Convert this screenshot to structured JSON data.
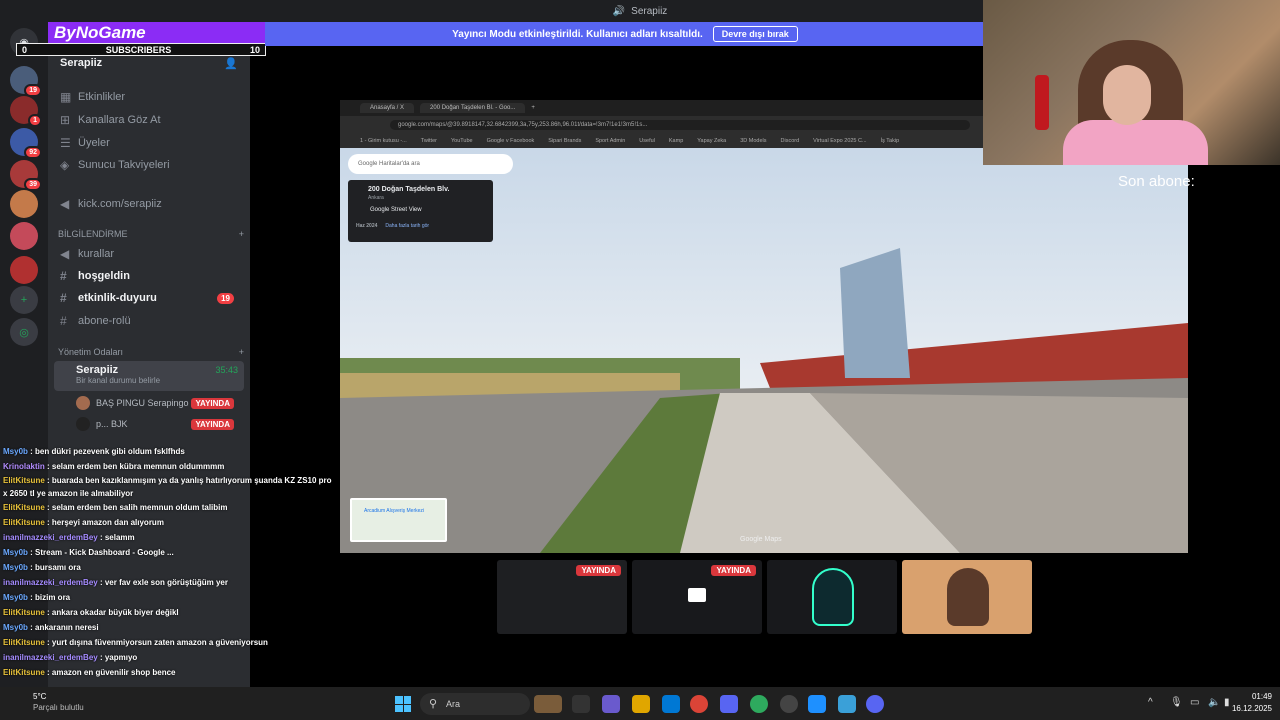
{
  "window": {
    "title": "Serapiiz"
  },
  "notice": {
    "text": "Yayıncı Modu etkinleştirildi. Kullanıcı adları kısaltıldı.",
    "button": "Devre dışı bırak"
  },
  "overlay": {
    "brand": "ByNoGame",
    "subscribers_label": "SUBSCRIBERS",
    "subs_left": "0",
    "subs_right": "10",
    "last_sub": "Son abone:"
  },
  "servers": [
    {
      "icon": "discord-icon",
      "badge": ""
    },
    {
      "icon": "server-icon",
      "badge": "19"
    },
    {
      "icon": "server-icon",
      "badge": "1"
    },
    {
      "icon": "server-icon",
      "badge": "92"
    },
    {
      "icon": "server-icon",
      "badge": "39"
    },
    {
      "icon": "server-icon",
      "badge": ""
    },
    {
      "icon": "server-icon",
      "badge": ""
    },
    {
      "icon": "server-icon",
      "badge": ""
    }
  ],
  "sidebar": {
    "server_name": "Serapiiz",
    "items": {
      "events": "Etkinlikler",
      "browse": "Kanallara Göz At",
      "members": "Üyeler",
      "boosts": "Sunucu Takviyeleri",
      "kick": "kick.com/serapiiz"
    },
    "cat_info": "BİLGİLENDİRME",
    "channels": {
      "rules": "kurallar",
      "welcome": "hoşgeldin",
      "events": "etkinlik-duyuru",
      "events_count": "19",
      "subrole": "abone-rolü"
    },
    "cat_admin": "Yönetim Odaları",
    "voice": {
      "name": "Serapiiz",
      "time": "35:43",
      "status": "Bir kanal durumu belirle"
    },
    "voice_users": [
      {
        "name": "BAŞ PINGU Serapingo",
        "live": "YAYINDA"
      },
      {
        "name": "p... BJK",
        "live": "YAYINDA"
      }
    ]
  },
  "chat": [
    {
      "user": "Msy0b",
      "color": "#6ba8ff",
      "text": "ben dükri pezevenk gibi oldum fsklfhds"
    },
    {
      "user": "Krinolaktin",
      "color": "#b38cff",
      "text": "selam erdem ben kübra memnun oldummmm"
    },
    {
      "user": "ElitKitsune",
      "color": "#e8c23a",
      "text": "buarada ben kazıklanmışım ya da yanlış hatırlıyorum şuanda KZ ZS10 pro x 2650 tl ye amazon ile almabiliyor"
    },
    {
      "user": "ElitKitsune",
      "color": "#e8c23a",
      "text": "selam erdem ben salih memnun oldum talibim"
    },
    {
      "user": "ElitKitsune",
      "color": "#e8c23a",
      "text": "herşeyi amazon dan alıyorum"
    },
    {
      "user": "inanilmazzeki_erdemBey",
      "color": "#a58bff",
      "text": "selamm"
    },
    {
      "user": "Msy0b",
      "color": "#6ba8ff",
      "text": "Stream - Kick Dashboard - Google ..."
    },
    {
      "user": "Msy0b",
      "color": "#6ba8ff",
      "text": "bursamı ora"
    },
    {
      "user": "inanilmazzeki_erdemBey",
      "color": "#a58bff",
      "text": "ver fav exle son görüştüğüm yer"
    },
    {
      "user": "Msy0b",
      "color": "#6ba8ff",
      "text": "bizim ora"
    },
    {
      "user": "ElitKitsune",
      "color": "#e8c23a",
      "text": "ankara okadar büyük biyer değikl"
    },
    {
      "user": "Msy0b",
      "color": "#6ba8ff",
      "text": "ankaranın neresi"
    },
    {
      "user": "ElitKitsune",
      "color": "#e8c23a",
      "text": "yurt dışına füvenmiyorsun zaten amazon a güveniyorsun"
    },
    {
      "user": "inanilmazzeki_erdemBey",
      "color": "#a58bff",
      "text": "yapmıyo"
    },
    {
      "user": "ElitKitsune",
      "color": "#e8c23a",
      "text": "amazon en güvenilir shop bence"
    }
  ],
  "browser": {
    "tabs": [
      "Anasayfa / X",
      "200 Doğan Taşdelen Bl. - Goo..."
    ],
    "url": "google.com/maps/@39.8918147,32.6842399,3a,75y,253.86h,96.01t/data=!3m7!1e1!3m5!1s...",
    "bookmarks": [
      "1 - Girim kutusu -...",
      "Twitter",
      "YouTube",
      "Google v Facebook",
      "Sipari Brands",
      "Sport Admin",
      "Useful",
      "Kamp",
      "Yapay Zeka",
      "3D Models",
      "Discord",
      "Virtual Expo 2025 C...",
      "İş Takip"
    ]
  },
  "streetview": {
    "search_placeholder": "Google Haritalar'da ara",
    "place": "200 Doğan Taşdelen Blv.",
    "city": "Ankara",
    "source": "Google Street View",
    "date": "Haz 2024",
    "more_dates": "Daha fazla tarih gör",
    "minimap_label": "Arcadium Alışveriş Merkezi",
    "watermark": "Google Maps"
  },
  "thumbs": [
    {
      "live": "YAYINDA"
    },
    {
      "live": "YAYINDA"
    },
    {
      "live": ""
    },
    {
      "live": ""
    }
  ],
  "taskbar": {
    "temp": "5°C",
    "condition": "Parçalı bulutlu",
    "search": "Ara",
    "time": "01:49",
    "date": "16.12.2025"
  }
}
